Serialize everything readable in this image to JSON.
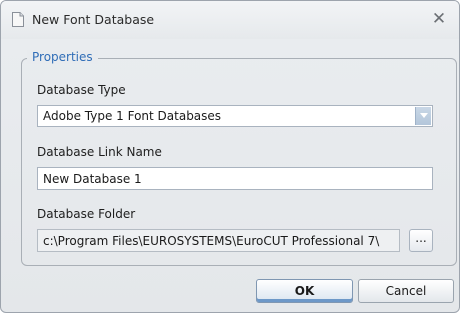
{
  "window": {
    "title": "New Font Database",
    "close_glyph": "✕"
  },
  "properties": {
    "legend": "Properties",
    "database_type": {
      "label": "Database Type",
      "value": "Adobe Type 1 Font Databases"
    },
    "link_name": {
      "label": "Database Link Name",
      "value": "New Database 1"
    },
    "folder": {
      "label": "Database Folder",
      "value": "c:\\Program Files\\EUROSYSTEMS\\EuroCUT Professional 7\\",
      "browse_label": "..."
    }
  },
  "buttons": {
    "ok": "OK",
    "cancel": "Cancel"
  },
  "icons": {
    "app": "document-icon",
    "close": "close-icon",
    "dropdown": "chevron-down-icon"
  },
  "colors": {
    "legend": "#2f6db7",
    "ok_accent": "#6d98c8"
  }
}
